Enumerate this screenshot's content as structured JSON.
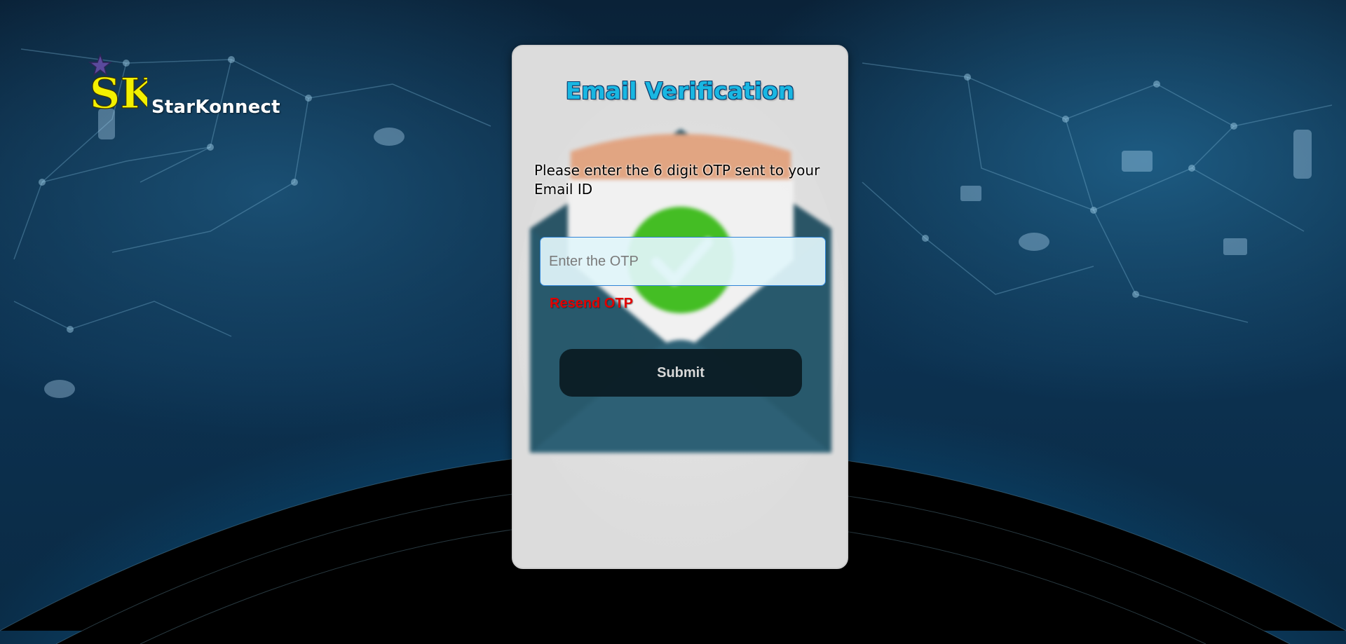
{
  "brand": {
    "logo_text": "SK",
    "name": "StarKonnect"
  },
  "card": {
    "title": "Email Verification",
    "instruction": "Please enter the 6 digit OTP sent to your Email ID",
    "otp_input": {
      "placeholder": "Enter the OTP",
      "value": ""
    },
    "resend_label": "Resend OTP",
    "submit_label": "Submit"
  },
  "colors": {
    "title": "#19b7e2",
    "resend": "#e00000",
    "submit_bg": "#0f1e26",
    "input_border": "#2f83d6",
    "card_bg": "#dcdcdc"
  },
  "icons": [
    "star-icon",
    "envelope-check-illustration"
  ]
}
